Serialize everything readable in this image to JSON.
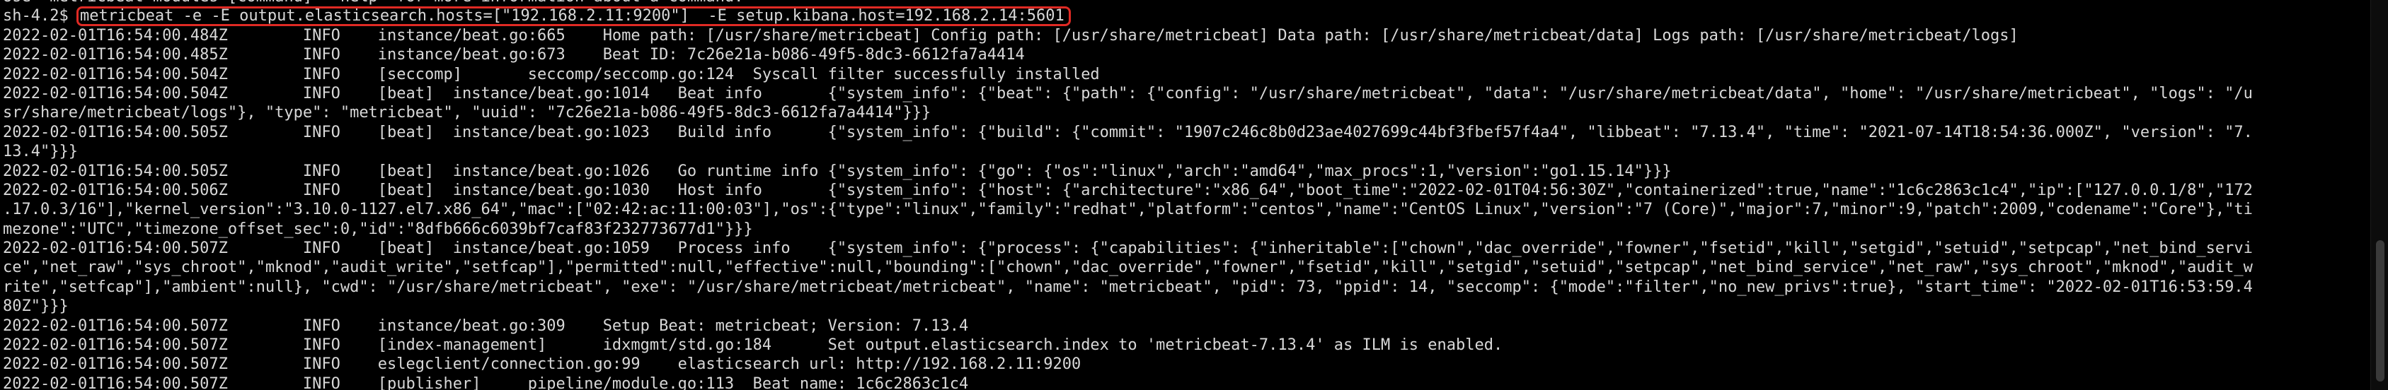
{
  "terminal": {
    "lines": [
      "Use \"metricbeat modules [command] --help\" for more information about a command.",
      "",
      "2022-02-01T16:54:00.484Z        INFO    instance/beat.go:665    Home path: [/usr/share/metricbeat] Config path: [/usr/share/metricbeat] Data path: [/usr/share/metricbeat/data] Logs path: [/usr/share/metricbeat/logs]",
      "2022-02-01T16:54:00.485Z        INFO    instance/beat.go:673    Beat ID: 7c26e21a-b086-49f5-8dc3-6612fa7a4414",
      "2022-02-01T16:54:00.504Z        INFO    [seccomp]       seccomp/seccomp.go:124  Syscall filter successfully installed",
      "2022-02-01T16:54:00.504Z        INFO    [beat]  instance/beat.go:1014   Beat info       {\"system_info\": {\"beat\": {\"path\": {\"config\": \"/usr/share/metricbeat\", \"data\": \"/usr/share/metricbeat/data\", \"home\": \"/usr/share/metricbeat\", \"logs\": \"/u",
      "sr/share/metricbeat/logs\"}, \"type\": \"metricbeat\", \"uuid\": \"7c26e21a-b086-49f5-8dc3-6612fa7a4414\"}}}",
      "2022-02-01T16:54:00.505Z        INFO    [beat]  instance/beat.go:1023   Build info      {\"system_info\": {\"build\": {\"commit\": \"1907c246c8b0d23ae4027699c44bf3fbef57f4a4\", \"libbeat\": \"7.13.4\", \"time\": \"2021-07-14T18:54:36.000Z\", \"version\": \"7.",
      "13.4\"}}}",
      "2022-02-01T16:54:00.505Z        INFO    [beat]  instance/beat.go:1026   Go runtime info {\"system_info\": {\"go\": {\"os\":\"linux\",\"arch\":\"amd64\",\"max_procs\":1,\"version\":\"go1.15.14\"}}}",
      "2022-02-01T16:54:00.506Z        INFO    [beat]  instance/beat.go:1030   Host info       {\"system_info\": {\"host\": {\"architecture\":\"x86_64\",\"boot_time\":\"2022-02-01T04:56:30Z\",\"containerized\":true,\"name\":\"1c6c2863c1c4\",\"ip\":[\"127.0.0.1/8\",\"172",
      ".17.0.3/16\"],\"kernel_version\":\"3.10.0-1127.el7.x86_64\",\"mac\":[\"02:42:ac:11:00:03\"],\"os\":{\"type\":\"linux\",\"family\":\"redhat\",\"platform\":\"centos\",\"name\":\"CentOS Linux\",\"version\":\"7 (Core)\",\"major\":7,\"minor\":9,\"patch\":2009,\"codename\":\"Core\"},\"ti",
      "mezone\":\"UTC\",\"timezone_offset_sec\":0,\"id\":\"8dfb666c6039bf7caf83f232773677d1\"}}}",
      "2022-02-01T16:54:00.507Z        INFO    [beat]  instance/beat.go:1059   Process info    {\"system_info\": {\"process\": {\"capabilities\": {\"inheritable\":[\"chown\",\"dac_override\",\"fowner\",\"fsetid\",\"kill\",\"setgid\",\"setuid\",\"setpcap\",\"net_bind_servi",
      "ce\",\"net_raw\",\"sys_chroot\",\"mknod\",\"audit_write\",\"setfcap\"],\"permitted\":null,\"effective\":null,\"bounding\":[\"chown\",\"dac_override\",\"fowner\",\"fsetid\",\"kill\",\"setgid\",\"setuid\",\"setpcap\",\"net_bind_service\",\"net_raw\",\"sys_chroot\",\"mknod\",\"audit_w",
      "rite\",\"setfcap\"],\"ambient\":null}, \"cwd\": \"/usr/share/metricbeat\", \"exe\": \"/usr/share/metricbeat/metricbeat\", \"name\": \"metricbeat\", \"pid\": 73, \"ppid\": 14, \"seccomp\": {\"mode\":\"filter\",\"no_new_privs\":true}, \"start_time\": \"2022-02-01T16:53:59.4",
      "80Z\"}}}",
      "2022-02-01T16:54:00.507Z        INFO    instance/beat.go:309    Setup Beat: metricbeat; Version: 7.13.4",
      "2022-02-01T16:54:00.507Z        INFO    [index-management]      idxmgmt/std.go:184      Set output.elasticsearch.index to 'metricbeat-7.13.4' as ILM is enabled.",
      "2022-02-01T16:54:00.507Z        INFO    eslegclient/connection.go:99    elasticsearch url: http://192.168.2.11:9200",
      "2022-02-01T16:54:00.507Z        INFO    [publisher]     pipeline/module.go:113  Beat name: 1c6c2863c1c4"
    ],
    "prompt": "sh-4.2$ ",
    "command": "metricbeat -e -E output.elasticsearch.hosts=[\"192.168.2.11:9200\"]  -E setup.kibana.host=192.168.2.14:5601",
    "highlight_color": "#e02a24",
    "background": "#000000",
    "foreground": "#d8d8d8"
  }
}
